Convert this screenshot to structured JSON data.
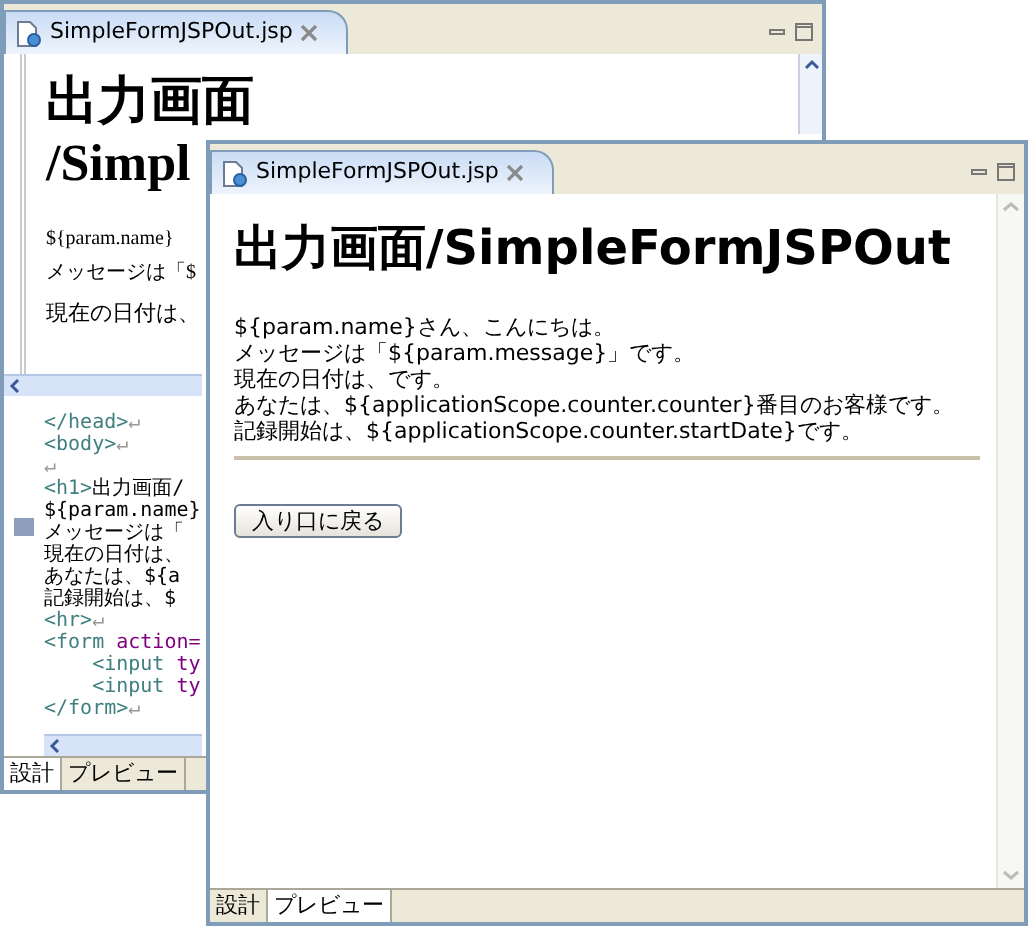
{
  "back_editor": {
    "tab_title": "SimpleFormJSPOut.jsp",
    "design": {
      "heading_lines": [
        "出力画面",
        "/Simpl"
      ],
      "lines": [
        "${param.name}",
        "メッセージは「$"
      ],
      "lines_2": [
        "現在の日付は、"
      ]
    },
    "source_lines": [
      [
        {
          "kind": "tag",
          "text": "</head>"
        },
        {
          "kind": "mark",
          "text": "↵"
        }
      ],
      [
        {
          "kind": "tag",
          "text": "<body>"
        },
        {
          "kind": "mark",
          "text": "↵"
        }
      ],
      [
        {
          "kind": "mark",
          "text": "↵"
        }
      ],
      [
        {
          "kind": "tag",
          "text": "<h1>"
        },
        {
          "kind": "text",
          "text": "出力画面/"
        }
      ],
      [
        {
          "kind": "text",
          "text": "${param.name}"
        }
      ],
      [
        {
          "kind": "text",
          "text": "メッセージは「"
        }
      ],
      [
        {
          "kind": "text",
          "text": "現在の日付は、"
        }
      ],
      [
        {
          "kind": "text",
          "text": "あなたは、${a"
        }
      ],
      [
        {
          "kind": "text",
          "text": "記録開始は、$"
        }
      ],
      [
        {
          "kind": "tag",
          "text": "<hr>"
        },
        {
          "kind": "mark",
          "text": "↵"
        }
      ],
      [
        {
          "kind": "tag",
          "text": "<form "
        },
        {
          "kind": "attr",
          "text": "action="
        }
      ],
      [
        {
          "kind": "tag",
          "text": "    <input "
        },
        {
          "kind": "attr",
          "text": "ty"
        }
      ],
      [
        {
          "kind": "tag",
          "text": "    <input "
        },
        {
          "kind": "attr",
          "text": "ty"
        }
      ],
      [
        {
          "kind": "tag",
          "text": "</form>"
        },
        {
          "kind": "mark",
          "text": "↵"
        }
      ]
    ],
    "bottom_tabs": [
      {
        "label": "設計",
        "selected": true
      },
      {
        "label": "プレビュー",
        "selected": false
      }
    ]
  },
  "front_editor": {
    "tab_title": "SimpleFormJSPOut.jsp",
    "heading": "出力画面/SimpleFormJSPOut",
    "lines": [
      "${param.name}さん、こんにちは。",
      "メッセージは「${param.message}」です。",
      "現在の日付は、です。",
      "あなたは、${applicationScope.counter.counter}番目のお客様です。",
      "記録開始は、${applicationScope.counter.startDate}です。"
    ],
    "button": "入り口に戻る",
    "bottom_tabs": [
      {
        "label": "設計",
        "selected": false
      },
      {
        "label": "プレビュー",
        "selected": true
      }
    ]
  }
}
